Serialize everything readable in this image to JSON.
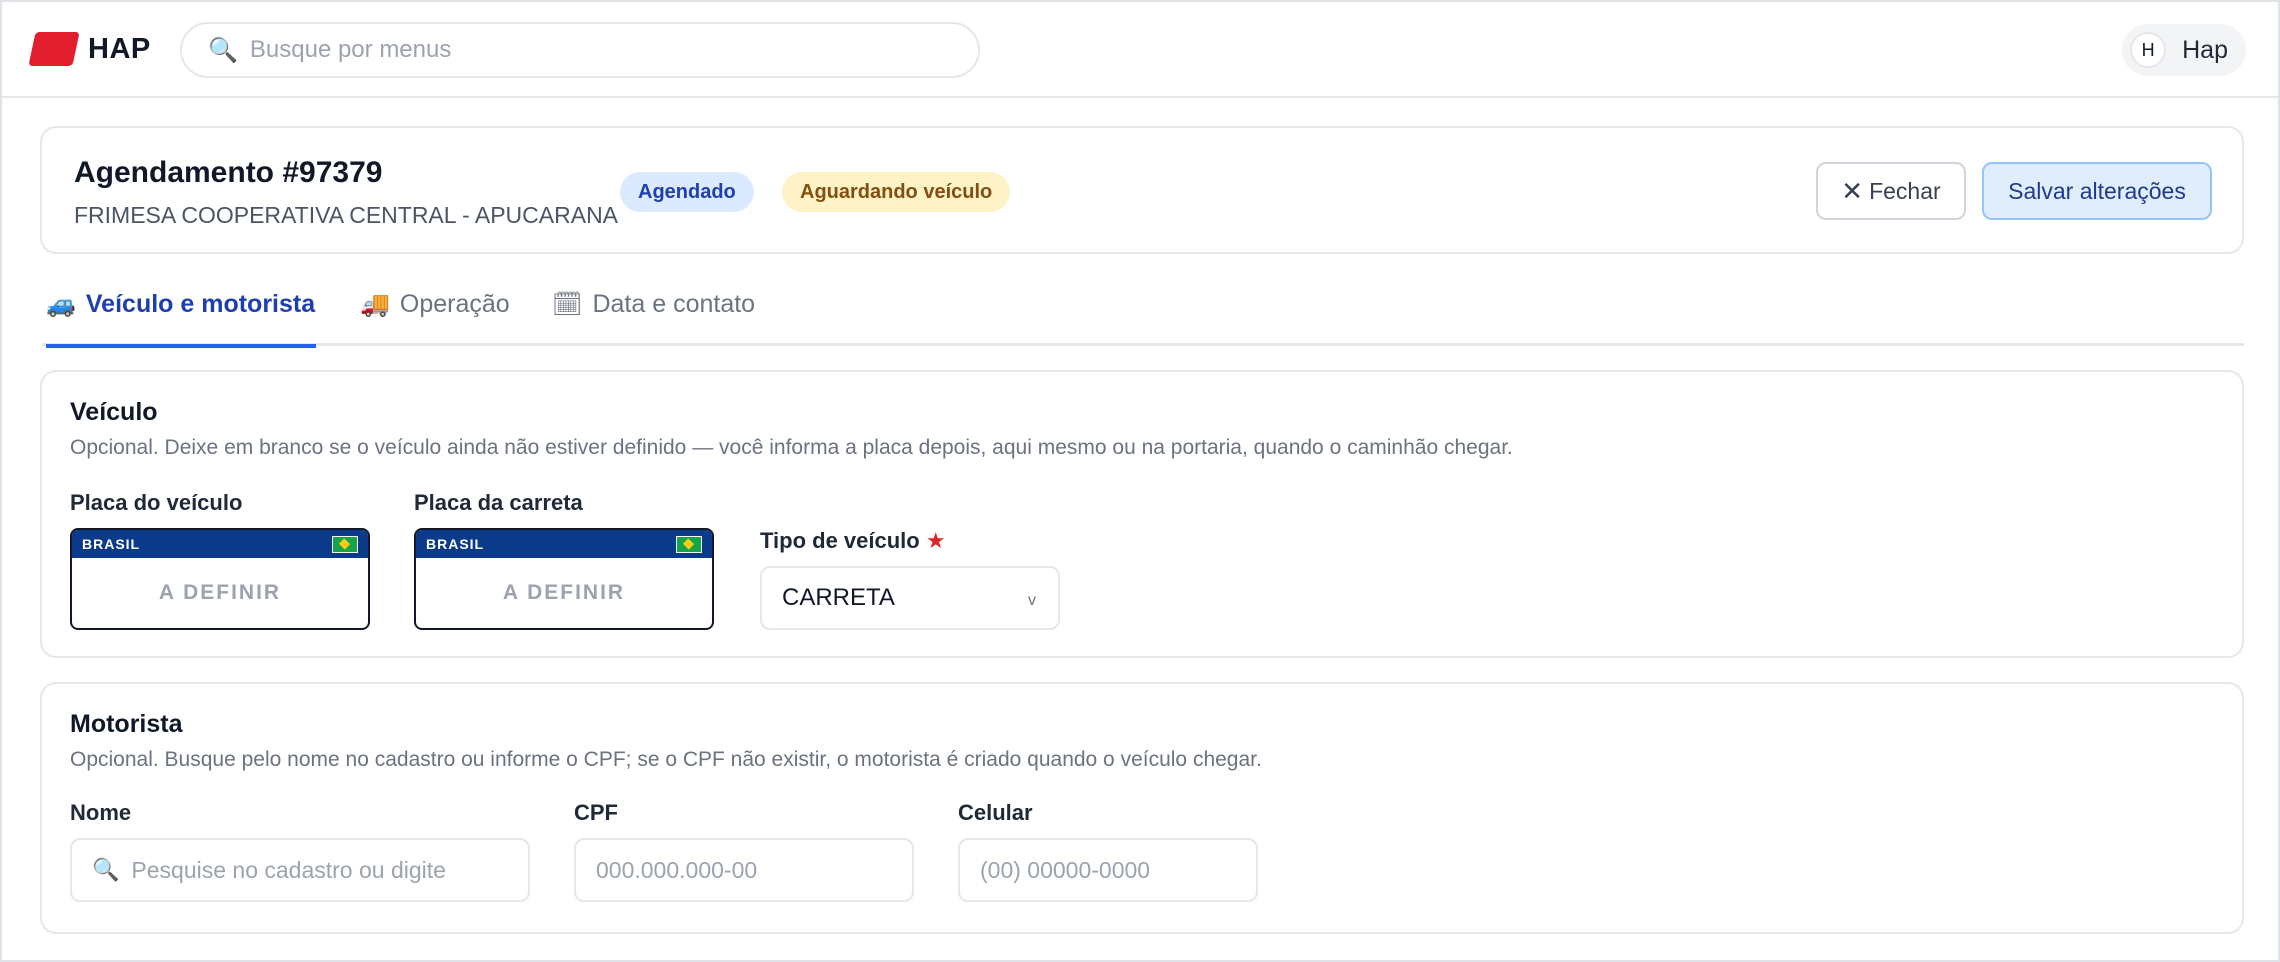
{
  "brand": {
    "name": "HAP"
  },
  "search": {
    "placeholder": "Busque por menus"
  },
  "user": {
    "initial": "H",
    "name": "Hap"
  },
  "header": {
    "title": "Agendamento #97379",
    "subtitle": "FRIMESA COOPERATIVA CENTRAL - APUCARANA",
    "badges": [
      "Agendado",
      "Aguardando veículo"
    ],
    "close_label": "Fechar",
    "save_label": "Salvar alterações"
  },
  "tabs": [
    {
      "icon": "🚙",
      "label": "Veículo e motorista",
      "active": true
    },
    {
      "icon": "🚚",
      "label": "Operação",
      "active": false
    },
    {
      "icon": "🗓",
      "label": "Data e contato",
      "active": false
    }
  ],
  "vehicle": {
    "title": "Veículo",
    "description": "Opcional. Deixe em branco se o veículo ainda não estiver definido — você informa a placa depois, aqui mesmo ou na portaria, quando o caminhão chegar.",
    "plate_label": "Placa do veículo",
    "trailer_label": "Placa da carreta",
    "plate_country": "BRASIL",
    "plate_value": "A DEFINIR",
    "trailer_value": "A DEFINIR",
    "type_label": "Tipo de veículo",
    "type_required_mark": "★",
    "type_value": "CARRETA",
    "type_chevron": "v"
  },
  "driver": {
    "title": "Motorista",
    "description": "Opcional. Busque pelo nome no cadastro ou informe o CPF; se o CPF não existir, o motorista é criado quando o veículo chegar.",
    "name_label": "Nome",
    "name_placeholder": "Pesquise no cadastro ou digite",
    "cpf_label": "CPF",
    "cpf_placeholder": "000.000.000-00",
    "phone_label": "Celular",
    "phone_placeholder": "(00) 00000-0000"
  },
  "colors": {
    "accent": "#2563eb",
    "brand": "#e11d2e",
    "plate_blue": "#0b3a8a"
  }
}
